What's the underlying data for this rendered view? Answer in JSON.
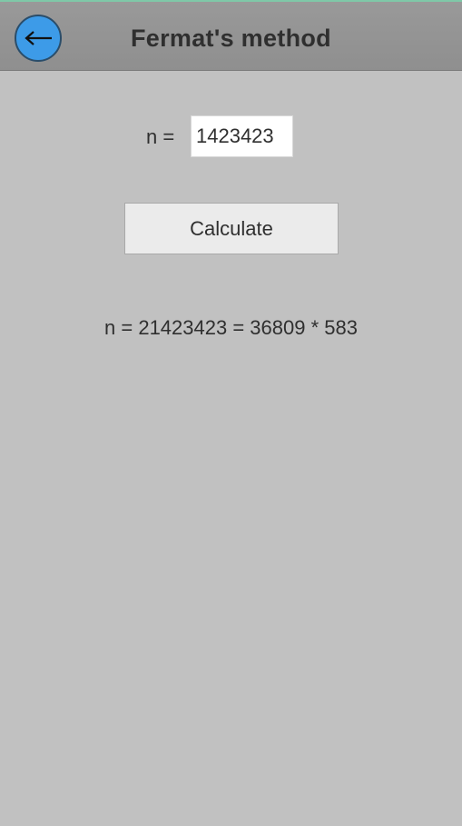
{
  "header": {
    "title": "Fermat's method",
    "back_icon": "left-arrow-icon",
    "back_color": "#3d9be8"
  },
  "form": {
    "n_label": "n =",
    "n_value": "1423423",
    "calculate_label": "Calculate"
  },
  "result": {
    "text": "n = 21423423 = 36809 * 583"
  }
}
